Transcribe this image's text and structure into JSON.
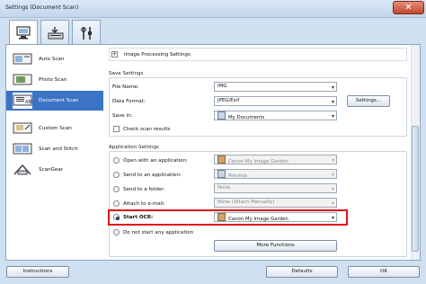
{
  "window": {
    "title": "Settings (Document Scan)",
    "close_glyph": "✕"
  },
  "tabs": [
    {
      "icon": "scan-from-computer-icon",
      "active": true
    },
    {
      "icon": "scan-from-panel-icon",
      "active": false
    },
    {
      "icon": "general-settings-icon",
      "active": false
    }
  ],
  "sidebar": {
    "items": [
      {
        "label": "Auto Scan",
        "icon": "auto-scan-icon",
        "selected": false
      },
      {
        "label": "Photo Scan",
        "icon": "photo-scan-icon",
        "selected": false
      },
      {
        "label": "Document Scan",
        "icon": "document-scan-icon",
        "selected": true
      },
      {
        "label": "Custom Scan",
        "icon": "custom-scan-icon",
        "selected": false
      },
      {
        "label": "Scan and Stitch",
        "icon": "scan-and-stitch-icon",
        "selected": false
      },
      {
        "label": "ScanGear",
        "icon": "scangear-icon",
        "selected": false
      }
    ]
  },
  "content": {
    "image_processing": {
      "expander": "+",
      "label": "Image Processing Settings"
    },
    "save_settings": {
      "title": "Save Settings",
      "file_name_label": "File Name:",
      "file_name_value": "IMG",
      "data_format_label": "Data Format:",
      "data_format_value": "JPEG/Exif",
      "settings_button": "Settings...",
      "save_in_label": "Save in:",
      "save_in_value": "My Documents",
      "check_results_label": "Check scan results"
    },
    "application_settings": {
      "title": "Application Settings",
      "open_app_label": "Open with an application:",
      "open_app_value": "Canon My Image Garden",
      "send_app_label": "Send to an application:",
      "send_app_value": "Preview",
      "send_folder_label": "Send to a folder:",
      "send_folder_value": "None",
      "attach_email_label": "Attach to e-mail:",
      "attach_email_value": "None (Attach Manually)",
      "start_ocr_label": "Start OCR:",
      "start_ocr_value": "Canon My Image Garden",
      "no_app_label": "Do not start any application",
      "more_functions_button": "More Functions",
      "selected_option": "start_ocr"
    }
  },
  "footer": {
    "instructions": "Instructions",
    "defaults": "Defaults",
    "ok": "OK"
  },
  "colors": {
    "selection": "#3b73c6",
    "highlight": "#e2131a",
    "window_bg": "#cfe0f0"
  }
}
